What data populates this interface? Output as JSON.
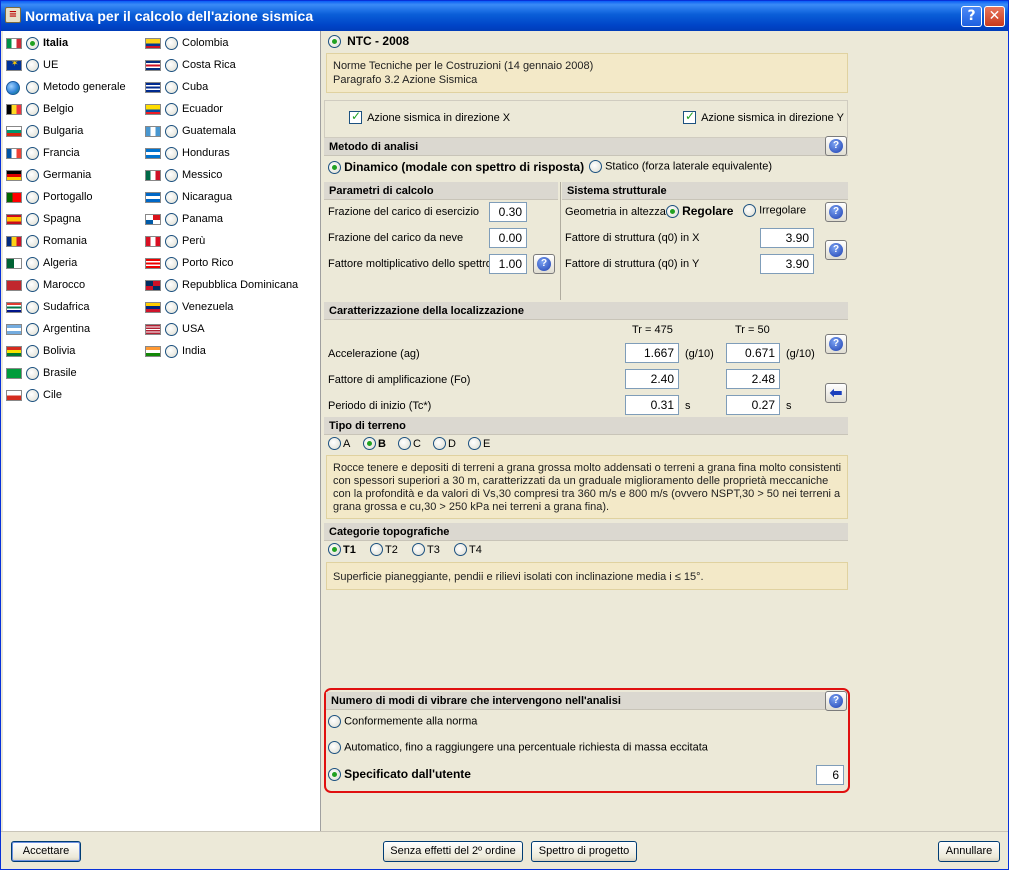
{
  "window": {
    "title": "Normativa per il calcolo dell'azione sismica"
  },
  "countries_col1": [
    {
      "label": "Italia",
      "selected": true,
      "flag": "it"
    },
    {
      "label": "UE",
      "selected": false,
      "flag": "eu"
    },
    {
      "label": "Metodo generale",
      "selected": false,
      "flag": "globe"
    },
    {
      "label": "Belgio",
      "selected": false,
      "flag": "be"
    },
    {
      "label": "Bulgaria",
      "selected": false,
      "flag": "bg"
    },
    {
      "label": "Francia",
      "selected": false,
      "flag": "fr"
    },
    {
      "label": "Germania",
      "selected": false,
      "flag": "de"
    },
    {
      "label": "Portogallo",
      "selected": false,
      "flag": "pt"
    },
    {
      "label": "Spagna",
      "selected": false,
      "flag": "es"
    },
    {
      "label": "Romania",
      "selected": false,
      "flag": "ro"
    },
    {
      "label": "Algeria",
      "selected": false,
      "flag": "dz"
    },
    {
      "label": "Marocco",
      "selected": false,
      "flag": "ma"
    },
    {
      "label": "Sudafrica",
      "selected": false,
      "flag": "za"
    },
    {
      "label": "Argentina",
      "selected": false,
      "flag": "ar"
    },
    {
      "label": "Bolivia",
      "selected": false,
      "flag": "bo"
    },
    {
      "label": "Brasile",
      "selected": false,
      "flag": "br"
    },
    {
      "label": "Cile",
      "selected": false,
      "flag": "cl"
    }
  ],
  "countries_col2": [
    {
      "label": "Colombia",
      "selected": false,
      "flag": "co"
    },
    {
      "label": "Costa Rica",
      "selected": false,
      "flag": "cr"
    },
    {
      "label": "Cuba",
      "selected": false,
      "flag": "cu"
    },
    {
      "label": "Ecuador",
      "selected": false,
      "flag": "ec"
    },
    {
      "label": "Guatemala",
      "selected": false,
      "flag": "gt"
    },
    {
      "label": "Honduras",
      "selected": false,
      "flag": "hn"
    },
    {
      "label": "Messico",
      "selected": false,
      "flag": "mx"
    },
    {
      "label": "Nicaragua",
      "selected": false,
      "flag": "ni"
    },
    {
      "label": "Panama",
      "selected": false,
      "flag": "pa"
    },
    {
      "label": "Perù",
      "selected": false,
      "flag": "pe"
    },
    {
      "label": "Porto Rico",
      "selected": false,
      "flag": "pr"
    },
    {
      "label": "Repubblica Dominicana",
      "selected": false,
      "flag": "do"
    },
    {
      "label": "Venezuela",
      "selected": false,
      "flag": "ve"
    },
    {
      "label": "USA",
      "selected": false,
      "flag": "us"
    },
    {
      "label": "India",
      "selected": false,
      "flag": "in"
    }
  ],
  "norm": {
    "label": "NTC - 2008",
    "info_line1": "Norme Tecniche per le Costruzioni (14 gennaio 2008)",
    "info_line2": "Paragrafo 3.2 Azione Sismica"
  },
  "directions": {
    "x_label": "Azione sismica in direzione X",
    "y_label": "Azione sismica in direzione Y"
  },
  "method": {
    "title": "Metodo di analisi",
    "dynamic_label": "Dinamico (modale con spettro di risposta)",
    "static_label": "Statico (forza laterale equivalente)"
  },
  "params": {
    "title": "Parametri di calcolo",
    "rows": [
      {
        "label": "Frazione del carico di esercizio",
        "value": "0.30"
      },
      {
        "label": "Frazione del carico da neve",
        "value": "0.00"
      },
      {
        "label": "Fattore moltiplicativo dello spettro",
        "value": "1.00"
      }
    ]
  },
  "system": {
    "title": "Sistema strutturale",
    "geometry_label": "Geometria in altezza",
    "regular_label": "Regolare",
    "irregular_label": "Irregolare",
    "qx_label": "Fattore di struttura (q0) in X",
    "qx_value": "3.90",
    "qy_label": "Fattore di struttura (q0) in Y",
    "qy_value": "3.90"
  },
  "location": {
    "title": "Caratterizzazione della localizzazione",
    "tr1": "Tr = 475",
    "tr2": "Tr = 50",
    "rows": [
      {
        "label": "Accelerazione (ag)",
        "v1": "1.667",
        "u1": "(g/10)",
        "v2": "0.671",
        "u2": "(g/10)"
      },
      {
        "label": "Fattore di amplificazione (Fo)",
        "v1": "2.40",
        "u1": "",
        "v2": "2.48",
        "u2": ""
      },
      {
        "label": "Periodo di inizio (Tc*)",
        "v1": "0.31",
        "u1": "s",
        "v2": "0.27",
        "u2": "s"
      }
    ]
  },
  "soil": {
    "title": "Tipo di terreno",
    "options": [
      "A",
      "B",
      "C",
      "D",
      "E"
    ],
    "selected": "B",
    "description": "Rocce tenere e depositi di terreni a grana grossa molto addensati o terreni a grana fina molto consistenti con spessori superiori a 30 m, caratterizzati da un graduale miglioramento delle proprietà meccaniche con la profondità e da valori di Vs,30 compresi tra 360 m/s e 800 m/s (ovvero NSPT,30 > 50 nei terreni a grana grossa e cu,30 > 250 kPa nei terreni a grana fina)."
  },
  "topo": {
    "title": "Categorie topografiche",
    "options": [
      "T1",
      "T2",
      "T3",
      "T4"
    ],
    "selected": "T1",
    "description": "Superficie pianeggiante, pendii e rilievi isolati con inclinazione media i ≤ 15°."
  },
  "modes": {
    "title": "Numero di modi di vibrare che intervengono nell'analisi",
    "opt1": "Conformemente alla norma",
    "opt2": "Automatico, fino a raggiungere una percentuale richiesta di massa eccitata",
    "opt3": "Specificato dall'utente",
    "value": "6"
  },
  "buttons": {
    "accept": "Accettare",
    "second_order": "Senza effetti del 2º ordine",
    "spectrum": "Spettro di progetto",
    "cancel": "Annullare"
  },
  "colors": {
    "accent_red": "#e01010",
    "info_bg": "#f3e9c8",
    "window_bg": "#ece9d8"
  }
}
